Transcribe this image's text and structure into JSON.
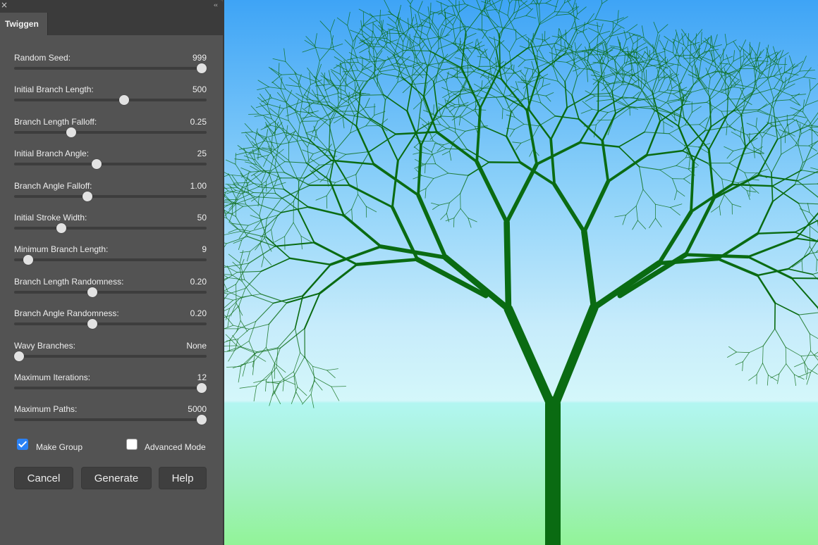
{
  "panel": {
    "close_glyph": "×",
    "collapse_glyph": "‹‹",
    "tab_label": "Twiggen"
  },
  "params": [
    {
      "label": "Random Seed:",
      "value": "999",
      "fraction": 0.975
    },
    {
      "label": "Initial Branch Length:",
      "value": "500",
      "fraction": 0.57
    },
    {
      "label": "Branch Length Falloff:",
      "value": "0.25",
      "fraction": 0.295
    },
    {
      "label": "Initial Branch Angle:",
      "value": "25",
      "fraction": 0.43
    },
    {
      "label": "Branch Angle Falloff:",
      "value": "1.00",
      "fraction": 0.38
    },
    {
      "label": "Initial Stroke Width:",
      "value": "50",
      "fraction": 0.245
    },
    {
      "label": "Minimum Branch Length:",
      "value": "9",
      "fraction": 0.075
    },
    {
      "label": "Branch Length Randomness:",
      "value": "0.20",
      "fraction": 0.405
    },
    {
      "label": "Branch Angle Randomness:",
      "value": "0.20",
      "fraction": 0.405
    },
    {
      "label": "Wavy Branches:",
      "value": "None",
      "fraction": 0.025
    },
    {
      "label": "Maximum Iterations:",
      "value": "12",
      "fraction": 0.975
    },
    {
      "label": "Maximum Paths:",
      "value": "5000",
      "fraction": 0.975
    }
  ],
  "options": {
    "make_group": {
      "label": "Make Group",
      "checked": true
    },
    "advanced_mode": {
      "label": "Advanced Mode",
      "checked": false
    }
  },
  "buttons": {
    "cancel": "Cancel",
    "generate": "Generate",
    "help": "Help"
  },
  "colors": {
    "panel_bg": "#535353",
    "accent_check": "#2a81f5",
    "tree_green": "#0a6b12",
    "sky_top": "#3ea4f6",
    "ground": "#92f398"
  },
  "icons": {
    "close": "close-icon",
    "collapse": "collapse-panel-icon",
    "checkbox": "checkbox-icon"
  }
}
